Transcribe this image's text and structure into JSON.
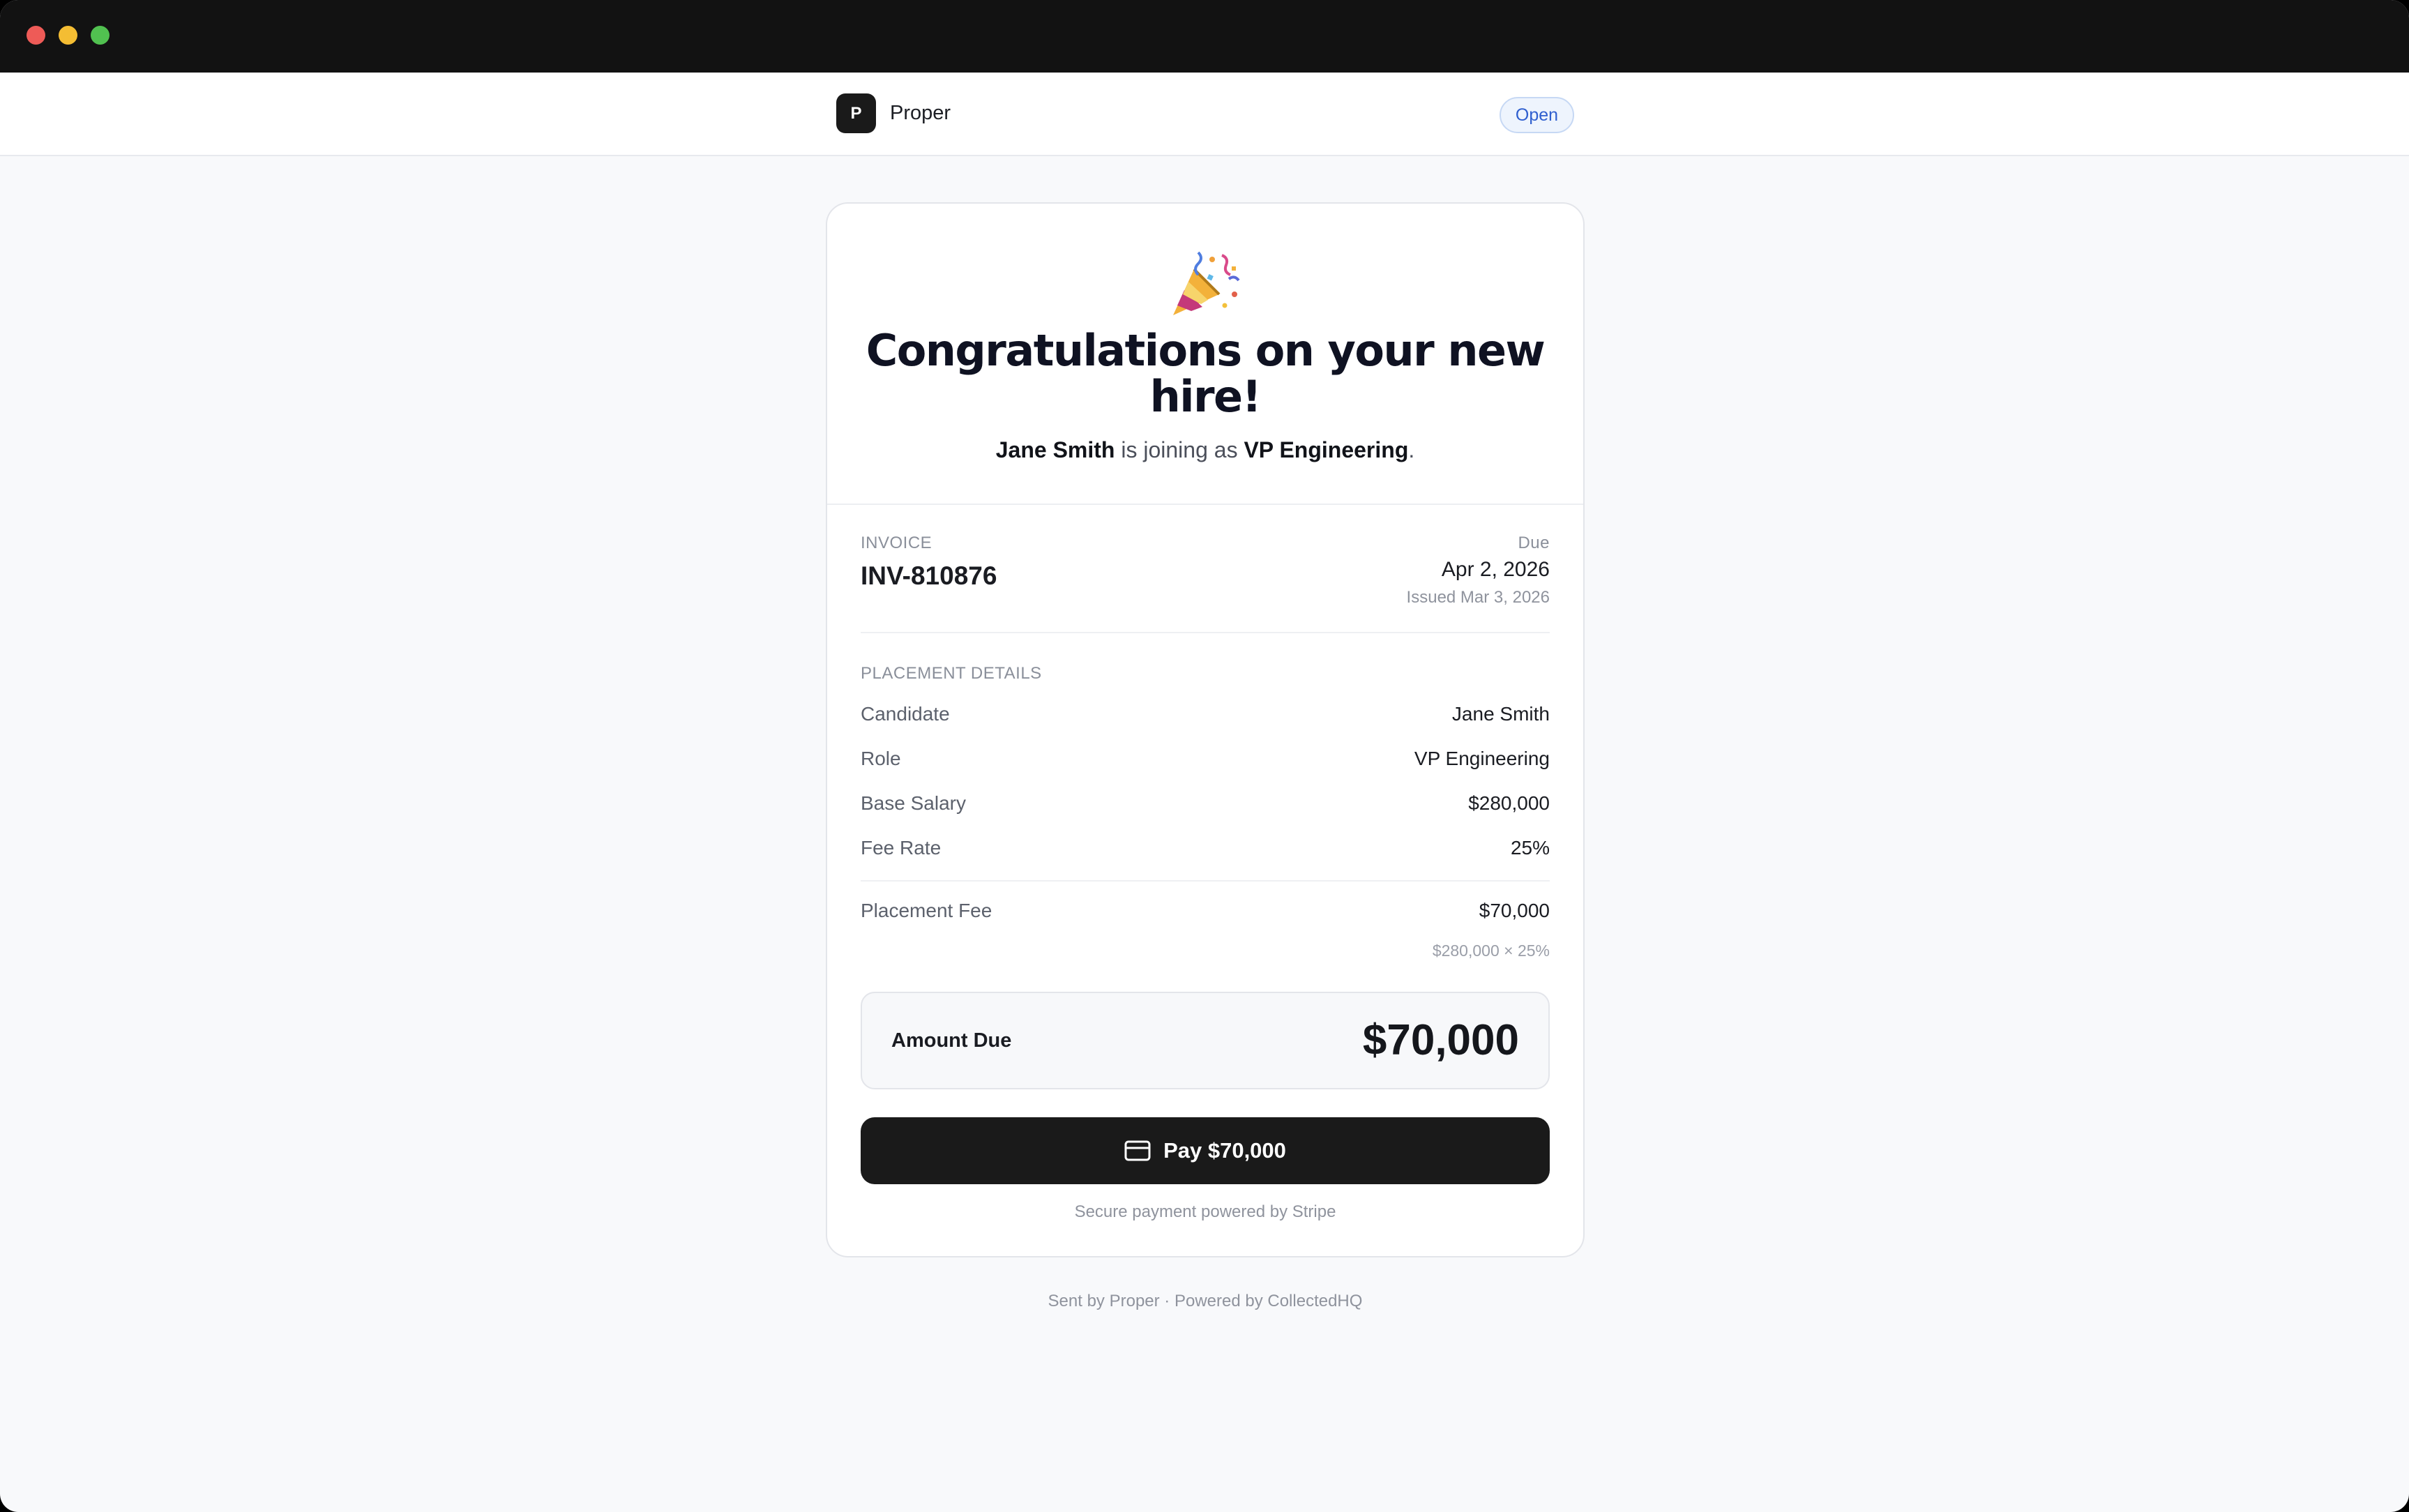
{
  "header": {
    "logo_letter": "P",
    "brand": "Proper",
    "status": "Open"
  },
  "hero": {
    "icon": "party-popper-icon",
    "title": "Congratulations on your new hire!",
    "candidate": "Jane Smith",
    "joining_text": " is joining as ",
    "role": "VP Engineering",
    "period": "."
  },
  "invoice": {
    "label": "INVOICE",
    "number": "INV-810876",
    "due_label": "Due",
    "due_date": "Apr 2, 2026",
    "issued": "Issued Mar 3, 2026"
  },
  "placement": {
    "header": "PLACEMENT DETAILS",
    "rows": [
      {
        "label": "Candidate",
        "value": "Jane Smith"
      },
      {
        "label": "Role",
        "value": "VP Engineering"
      },
      {
        "label": "Base Salary",
        "value": "$280,000"
      },
      {
        "label": "Fee Rate",
        "value": "25%"
      }
    ],
    "fee_label": "Placement Fee",
    "fee_value": "$70,000",
    "fee_calc": "$280,000 × 25%"
  },
  "amount_due": {
    "label": "Amount Due",
    "value": "$70,000"
  },
  "pay": {
    "icon": "credit-card-icon",
    "label": "Pay $70,000"
  },
  "secure_note": "Secure payment powered by Stripe",
  "footer": "Sent by Proper · Powered by CollectedHQ",
  "colors": {
    "primary_button": "#1a1a1a",
    "status_badge": "#2f5fcf",
    "page_bg": "#f8f9fb"
  }
}
